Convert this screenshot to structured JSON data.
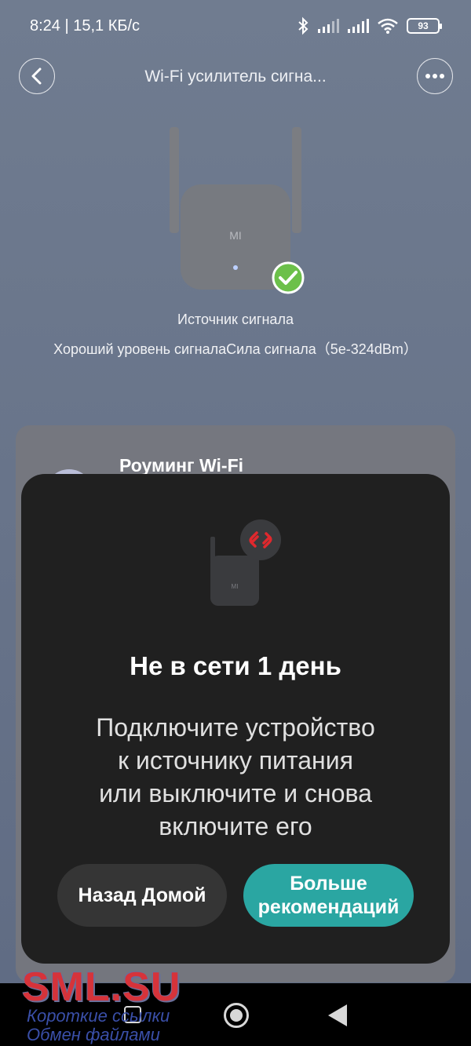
{
  "status_bar": {
    "time_speed": "8:24 | 15,1 КБ/с",
    "battery": "93"
  },
  "header": {
    "title": "Wi-Fi усилитель сигна..."
  },
  "device": {
    "logo": "MI",
    "caption": "Источник сигнала",
    "signal": "Хороший уровень сигналаСила сигнала（5e-324dBm）"
  },
  "background_card": {
    "title": "Роуминг Wi-Fi"
  },
  "modal": {
    "title": "Не в сети 1 день",
    "message": "Подключите устройство\nк источнику питания\nили выключите и снова\nвключите его",
    "home_button": "Назад Домой",
    "more_button": "Больше\nрекомендаций"
  },
  "watermark": {
    "logo": "SML.SU",
    "line1": "Короткие ссылки",
    "line2": "Обмен файлами"
  },
  "colors": {
    "accent": "#2aa6a2",
    "success": "#6cc04a",
    "error": "#e0282d"
  },
  "icons": {
    "bluetooth": "bluetooth-icon",
    "signal": "cellular-signal-icon",
    "wifi": "wifi-icon",
    "battery": "battery-icon",
    "back": "chevron-left-icon",
    "more": "more-horizontal-icon",
    "check": "check-icon",
    "link_broken": "broken-link-icon"
  }
}
